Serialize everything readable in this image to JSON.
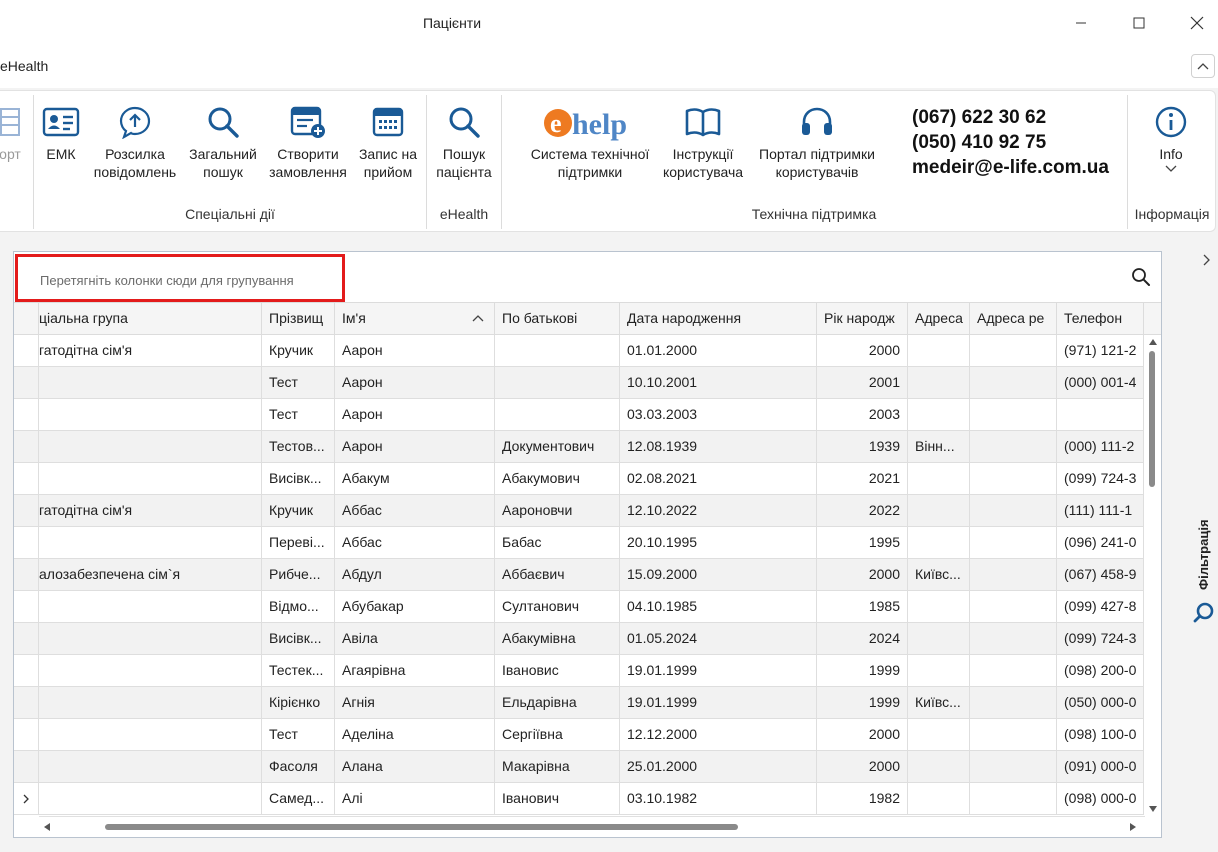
{
  "window": {
    "title": "Пацієнти",
    "tab": "eHealth"
  },
  "ribbon": {
    "partial_left_label": "орт",
    "buttons": [
      {
        "id": "emk",
        "label": "ЕМК",
        "icon": "id-card-icon"
      },
      {
        "id": "mailing",
        "label": "Розсилка\nповідомлень",
        "icon": "message-icon"
      },
      {
        "id": "search",
        "label": "Загальний\nпошук",
        "icon": "search-icon"
      },
      {
        "id": "order",
        "label": "Створити\nзамовлення",
        "icon": "create-order-icon"
      },
      {
        "id": "appointment",
        "label": "Запис на\nприйом",
        "icon": "calendar-icon"
      },
      {
        "id": "patient_search",
        "label": "Пошук\nпацієнта",
        "icon": "search-icon"
      },
      {
        "id": "support_system",
        "label": "Система технічної\nпідтримки",
        "icon": "ehelp-logo"
      },
      {
        "id": "instructions",
        "label": "Інструкції\nкористувача",
        "icon": "book-icon"
      },
      {
        "id": "portal",
        "label": "Портал підтримки\nкористувачів",
        "icon": "headset-icon"
      },
      {
        "id": "info",
        "label": "Info",
        "icon": "info-icon"
      }
    ],
    "groups": {
      "special": "Спеціальні дії",
      "ehealth": "eHealth",
      "tech": "Технічна підтримка",
      "info": "Інформація"
    },
    "logo": {
      "e": "e",
      "help": "help"
    },
    "contacts": {
      "phone1": "(067) 622 30 62",
      "phone2": "(050) 410 92 75",
      "email": "medeir@e-life.com.ua"
    }
  },
  "grid": {
    "group_placeholder": "Перетягніть колонки сюди для групування",
    "columns": [
      "ціальна група",
      "Прізвищ",
      "Ім'я",
      "По батькові",
      "Дата народження",
      "Рік народж",
      "Адреса",
      "Адреса ре",
      "Телефон"
    ],
    "sorted_column": "Ім'я",
    "rows": [
      [
        "гатодітна сім'я",
        "Кручик",
        "Аарон",
        "",
        "01.01.2000",
        "2000",
        "",
        "",
        "(971) 121-2"
      ],
      [
        "",
        "Тест",
        "Аарон",
        "",
        "10.10.2001",
        "2001",
        "",
        "",
        "(000) 001-4"
      ],
      [
        "",
        "Тест",
        "Аарон",
        "",
        "03.03.2003",
        "2003",
        "",
        "",
        ""
      ],
      [
        "",
        "Тестов...",
        "Аарон",
        "Документович",
        "12.08.1939",
        "1939",
        "Вінн...",
        "",
        "(000) 111-2"
      ],
      [
        "",
        "Висівк...",
        "Абакум",
        "Абакумович",
        "02.08.2021",
        "2021",
        "",
        "",
        "(099) 724-3"
      ],
      [
        "гатодітна сім'я",
        "Кручик",
        "Аббас",
        "Аароновчи",
        "12.10.2022",
        "2022",
        "",
        "",
        "(111) 111-1"
      ],
      [
        "",
        "Переві...",
        "Аббас",
        "Бабас",
        "20.10.1995",
        "1995",
        "",
        "",
        "(096) 241-0"
      ],
      [
        "алозабезпечена сім`я",
        "Рибче...",
        "Абдул",
        "Аббаєвич",
        "15.09.2000",
        "2000",
        "Київс...",
        "",
        "(067) 458-9"
      ],
      [
        "",
        "Відмо...",
        "Абубакар",
        "Султанович",
        "04.10.1985",
        "1985",
        "",
        "",
        "(099) 427-8"
      ],
      [
        "",
        "Висівк...",
        "Авіла",
        "Абакумівна",
        "01.05.2024",
        "2024",
        "",
        "",
        "(099) 724-3"
      ],
      [
        "",
        "Тестек...",
        "Агаярівна",
        "Івановис",
        "19.01.1999",
        "1999",
        "",
        "",
        "(098) 200-0"
      ],
      [
        "",
        "Кірієнко",
        "Агнія",
        "Ельдарівна",
        "19.01.1999",
        "1999",
        "Київс...",
        "",
        "(050) 000-0"
      ],
      [
        "",
        "Тест",
        "Аделіна",
        "Сергіївна",
        "12.12.2000",
        "2000",
        "",
        "",
        "(098) 100-0"
      ],
      [
        "",
        "Фасоля",
        "Алана",
        "Макарівна",
        "25.01.2000",
        "2000",
        "",
        "",
        "(091) 000-0"
      ],
      [
        "",
        "Самед...",
        "Алі",
        "Іванович",
        "03.10.1982",
        "1982",
        "",
        "",
        "(098) 000-0"
      ]
    ],
    "current_row": 14
  },
  "side": {
    "filter_label": "Фільтрація"
  },
  "colors": {
    "accent_blue": "#1a5a96",
    "highlight_red": "#e31b1b",
    "ehelp_orange": "#ee7a21",
    "ehelp_blue": "#4f86c6"
  }
}
